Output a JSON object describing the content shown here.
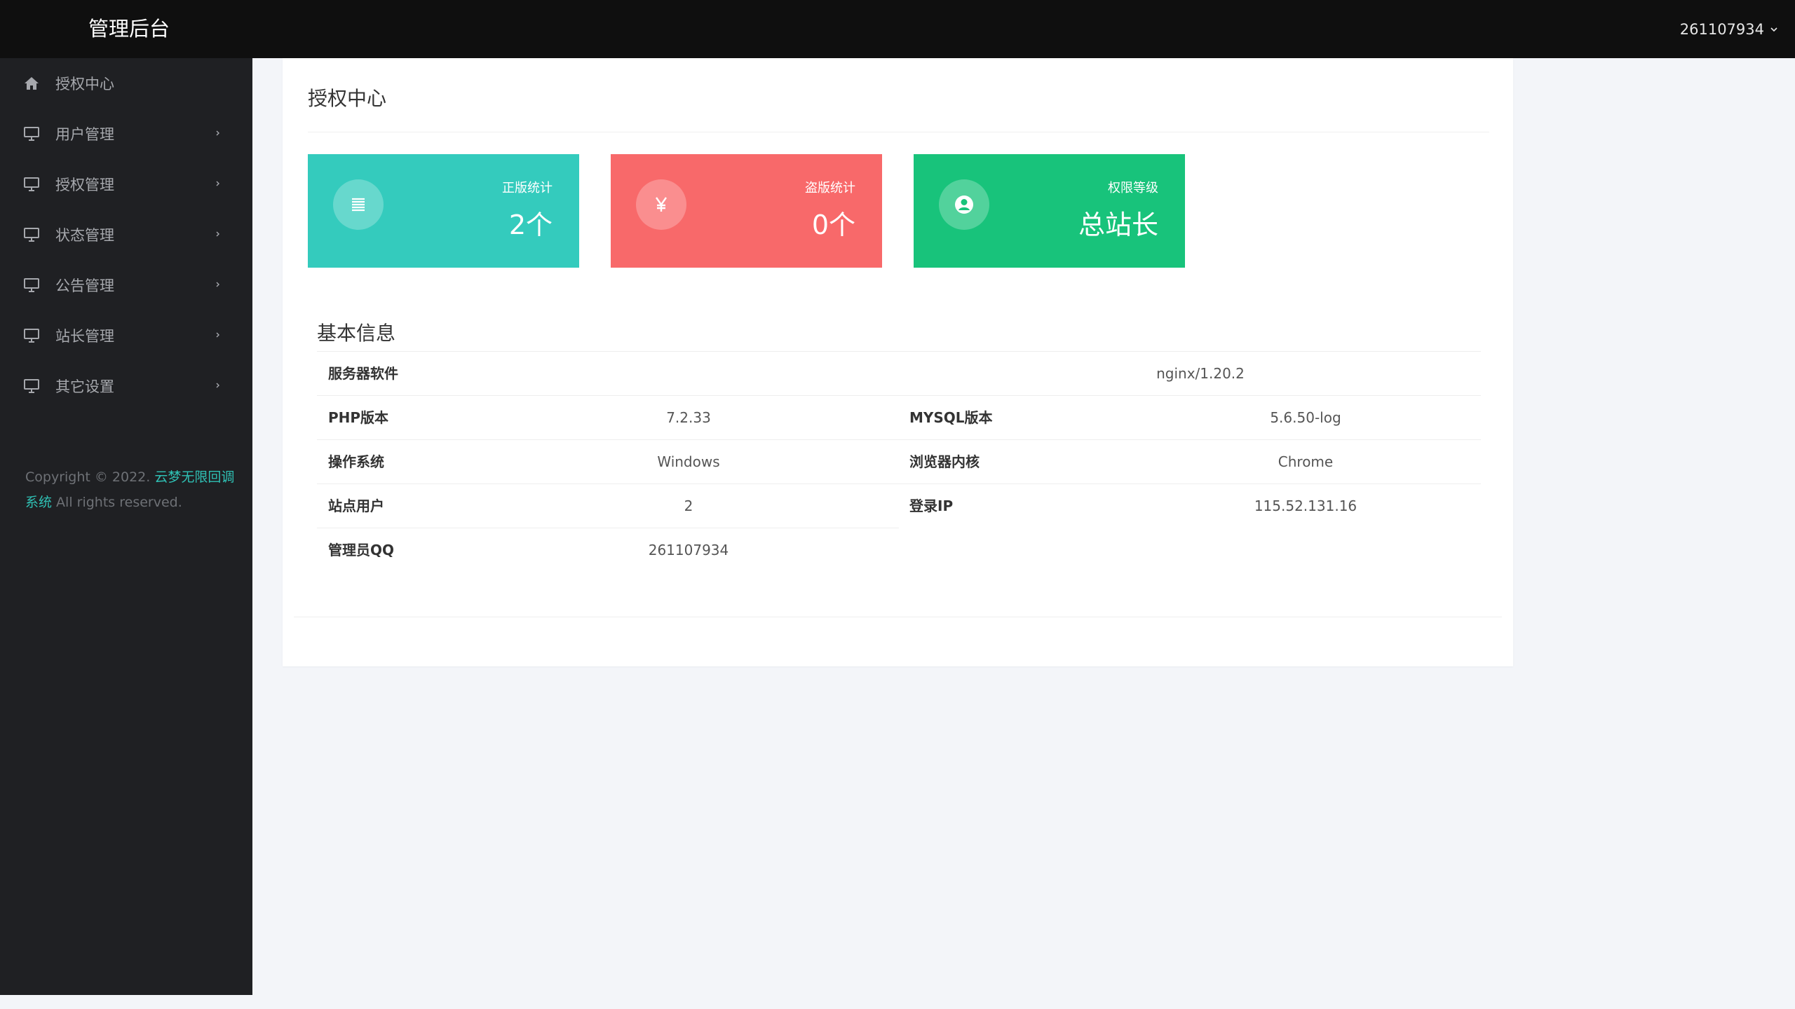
{
  "header": {
    "brand": "管理后台",
    "user": "261107934"
  },
  "sidebar": {
    "items": [
      {
        "label": "授权中心",
        "icon": "home-icon",
        "has_children": false
      },
      {
        "label": "用户管理",
        "icon": "monitor-icon",
        "has_children": true
      },
      {
        "label": "授权管理",
        "icon": "monitor-icon",
        "has_children": true
      },
      {
        "label": "状态管理",
        "icon": "monitor-icon",
        "has_children": true
      },
      {
        "label": "公告管理",
        "icon": "monitor-icon",
        "has_children": true
      },
      {
        "label": "站长管理",
        "icon": "monitor-icon",
        "has_children": true
      },
      {
        "label": "其它设置",
        "icon": "monitor-icon",
        "has_children": true
      }
    ],
    "copyright_prefix": "Copyright © 2022. ",
    "copyright_link": "云梦无限回调系统",
    "copyright_suffix": " All rights reserved."
  },
  "main": {
    "title": "授权中心",
    "stats": [
      {
        "label": "正版统计",
        "value": "2个",
        "icon": "list-icon",
        "color": "#34cbbd"
      },
      {
        "label": "盗版统计",
        "value": "0个",
        "icon": "yen-icon",
        "color": "#f8696a"
      },
      {
        "label": "权限等级",
        "value": "总站长",
        "icon": "user-circle-icon",
        "color": "#18c37b"
      }
    ],
    "info_title": "基本信息",
    "info": {
      "server_software_label": "服务器软件",
      "server_software_value": "nginx/1.20.2",
      "php_label": "PHP版本",
      "php_value": "7.2.33",
      "mysql_label": "MYSQL版本",
      "mysql_value": "5.6.50-log",
      "os_label": "操作系统",
      "os_value": "Windows",
      "browser_label": "浏览器内核",
      "browser_value": "Chrome",
      "users_label": "站点用户",
      "users_value": "2",
      "ip_label": "登录IP",
      "ip_value": "115.52.131.16",
      "qq_label": "管理员QQ",
      "qq_value": "261107934"
    }
  },
  "colors": {
    "topbar": "#0f0f0f",
    "sidebar": "#1f2023",
    "accent_link": "#2fc1b5",
    "background": "#f3f5f9"
  }
}
